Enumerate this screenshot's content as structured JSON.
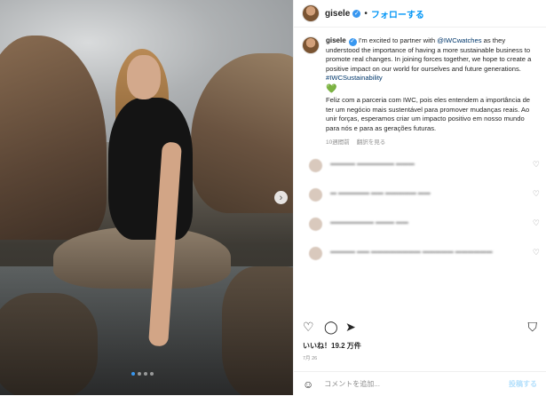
{
  "header": {
    "username": "gisele",
    "separator": "•",
    "follow_label": "フォローする"
  },
  "caption": {
    "username": "gisele",
    "text_en_1": "I'm excited to partner with ",
    "mention": "@IWCwatches",
    "text_en_2": " as they understood the importance of having a more sustainable business to promote real changes. In joining forces together, we hope to create a positive impact on our world for ourselves and future generations. ",
    "hashtag": "#IWCSustainability",
    "emoji": "💚",
    "text_pt": "Feliz com a parceria com IWC, pois eles entendem a importância de ter um negócio mais sustentável para promover mudanças reais. Ao unir forças, esperamos criar um impacto positivo em nosso mundo para nós e para as gerações futuras.",
    "time": "10週間前",
    "see_translation": "翻訳を見る"
  },
  "comments": [
    {
      "text": "▬▬▬▬ ▬▬▬▬▬▬ ▬▬▬"
    },
    {
      "text": "▬ ▬▬▬▬▬ ▬▬ ▬▬▬▬▬ ▬▬"
    },
    {
      "text": "▬▬▬▬▬▬▬ ▬▬▬ ▬▬"
    },
    {
      "text": "▬▬▬▬ ▬▬ ▬▬▬▬▬▬▬▬ ▬▬▬▬▬ ▬▬▬▬▬▬"
    }
  ],
  "likes": "いいね！19.2 万件",
  "date": "7月 26",
  "composer": {
    "placeholder": "コメントを追加...",
    "post_label": "投稿する"
  },
  "icons": {
    "heart": "heart-icon",
    "comment": "comment-icon",
    "share": "share-icon",
    "save": "bookmark-icon",
    "next": "chevron-right-icon",
    "emoji": "emoji-icon"
  },
  "colors": {
    "link": "#00376b",
    "accent": "#0095f6",
    "verified": "#3897f0",
    "muted": "#8e8e8e"
  },
  "carousel": {
    "total": 4,
    "active": 1
  }
}
